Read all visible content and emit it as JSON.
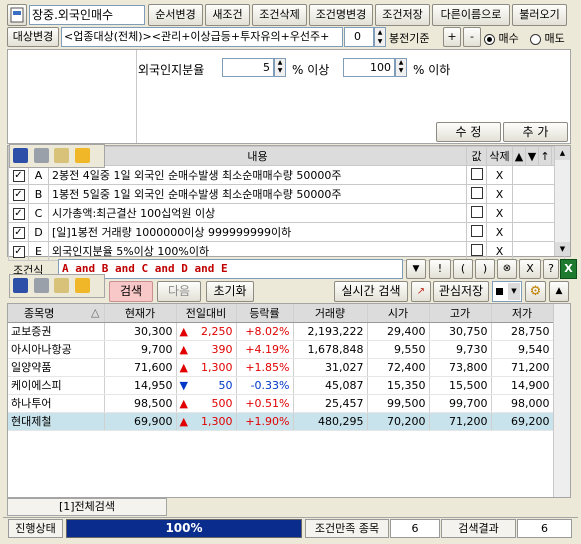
{
  "top": {
    "name_value": "장중.외국인매수",
    "buttons": [
      "순서변경",
      "새조건",
      "조건삭제",
      "조건명변경",
      "조건저장",
      "다른이름으로",
      "불러오기"
    ]
  },
  "target": {
    "label": "대상변경",
    "value": "<업종대상(전체)><관리+이상급등+투자유의+우선주+",
    "bong_value": "0",
    "bong_label": "봉전기준",
    "plus": "+",
    "minus": "-",
    "radio_buy": "매수",
    "radio_sell": "매도"
  },
  "criteria": {
    "label": "외국인지분율",
    "min_value": "5",
    "min_unit": "% 이상",
    "max_value": "100",
    "max_unit": "% 이하"
  },
  "edit_buttons": {
    "modify": "수 정",
    "add": "추 가"
  },
  "conditions": {
    "headers": {
      "content": "내용",
      "value": "값",
      "delete": "삭제"
    },
    "rows": [
      {
        "id": "A",
        "text": "2봉전 4일중 1일 외국인 순매수발생 최소순매매수량 50000주",
        "del": "X"
      },
      {
        "id": "B",
        "text": "1봉전 5일중 1일 외국인 순매수발생 최소순매매수량 50000주",
        "del": "X"
      },
      {
        "id": "C",
        "text": "시가총액:최근결산 100십억원 이상",
        "del": "X"
      },
      {
        "id": "D",
        "text": "[일]1봉전 거래량 1000000이상 999999999이하",
        "del": "X"
      },
      {
        "id": "E",
        "text": "외국인지분율 5%이상 100%이하",
        "del": "X"
      }
    ]
  },
  "formula": {
    "label": "조건식",
    "value": "A and B and C and D and E",
    "ops": [
      "!",
      "(",
      ")",
      "X",
      "?"
    ]
  },
  "search_bar": {
    "search": "검색",
    "next": "다음",
    "reset": "초기화",
    "realtime": "실시간 검색",
    "watch_save": "관심저장"
  },
  "results": {
    "headers": [
      "종목명",
      "현재가",
      "전일대비",
      "등락률",
      "거래량",
      "시가",
      "고가",
      "저가"
    ],
    "rows": [
      {
        "name": "교보증권",
        "price": "30,300",
        "dir": "up",
        "change": "2,250",
        "rate": "+8.02%",
        "volume": "2,193,222",
        "open": "29,400",
        "high": "30,750",
        "low": "28,750"
      },
      {
        "name": "아시아나항공",
        "price": "9,700",
        "dir": "up",
        "change": "390",
        "rate": "+4.19%",
        "volume": "1,678,848",
        "open": "9,550",
        "high": "9,730",
        "low": "9,540"
      },
      {
        "name": "일양약품",
        "price": "71,600",
        "dir": "up",
        "change": "1,300",
        "rate": "+1.85%",
        "volume": "31,027",
        "open": "72,400",
        "high": "73,800",
        "low": "71,200"
      },
      {
        "name": "케이에스피",
        "price": "14,950",
        "dir": "down",
        "change": "50",
        "rate": "-0.33%",
        "volume": "45,087",
        "open": "15,350",
        "high": "15,500",
        "low": "14,900"
      },
      {
        "name": "하나투어",
        "price": "98,500",
        "dir": "up",
        "change": "500",
        "rate": "+0.51%",
        "volume": "25,457",
        "open": "99,500",
        "high": "99,700",
        "low": "98,000"
      },
      {
        "name": "현대제철",
        "price": "69,900",
        "dir": "up",
        "change": "1,300",
        "rate": "+1.90%",
        "volume": "480,295",
        "open": "70,200",
        "high": "71,200",
        "low": "69,200"
      }
    ]
  },
  "bottom": {
    "tab": "[1]전체검색",
    "status_label": "진행상태",
    "progress_text": "100%",
    "progress": 1.0,
    "match_label": "조건만족 종목",
    "match_value": "6",
    "result_label": "검색결과",
    "result_value": "6"
  },
  "colors": {
    "up": "#e00000",
    "down": "#0037c8",
    "progress": "#0a2c8c",
    "highlight": "#c9e3ec"
  }
}
